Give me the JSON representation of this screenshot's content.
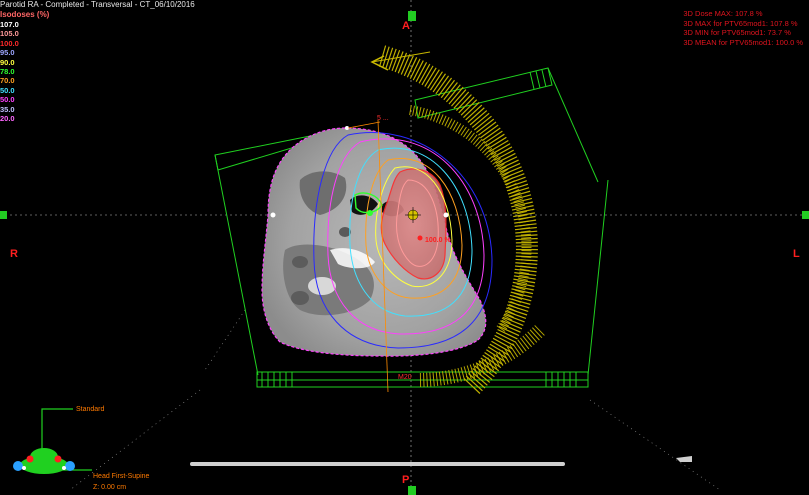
{
  "window": {
    "title": "Parotid RA - Completed - Transversal - CT_06/10/2016"
  },
  "isodoses": {
    "title": "Isodoses (%)",
    "levels": [
      {
        "label": "107.0",
        "color": "#ffffff"
      },
      {
        "label": "105.0",
        "color": "#ff9a9a"
      },
      {
        "label": "100.0",
        "color": "#ff2a2a"
      },
      {
        "label": "95.0",
        "color": "#9ca6ff"
      },
      {
        "label": "90.0",
        "color": "#ffff40"
      },
      {
        "label": "78.0",
        "color": "#30ff30"
      },
      {
        "label": "70.0",
        "color": "#ffa020"
      },
      {
        "label": "50.0",
        "color": "#40e0ff"
      },
      {
        "label": "50.0",
        "color": "#ff40ff"
      },
      {
        "label": "35.0",
        "color": "#c0c0ff"
      },
      {
        "label": "20.0",
        "color": "#ff66ff"
      }
    ]
  },
  "dose_stats": [
    "3D Dose MAX: 107.8 %",
    "3D MAX for PTV65mod1: 107.8 %",
    "3D MIN for PTV65mod1: 73.7 %",
    "3D MEAN for PTV65mod1: 100.0 %"
  ],
  "orientation_labels": {
    "anterior": "A",
    "posterior": "P",
    "right": "R",
    "left": "L"
  },
  "overlay": {
    "dose_point_label": "100.0 %",
    "scale_label": "M20",
    "angle_label": "5 ..."
  },
  "patient": {
    "preset": "Standard",
    "orientation": "Head First-Supine",
    "slice_position": "Z: 0.00 cm"
  },
  "colors": {
    "background": "#000000",
    "gantry_arc": "#c8b800",
    "collimator": "#20d020",
    "text_orange": "#ff7a00",
    "text_red": "#e0141e"
  }
}
